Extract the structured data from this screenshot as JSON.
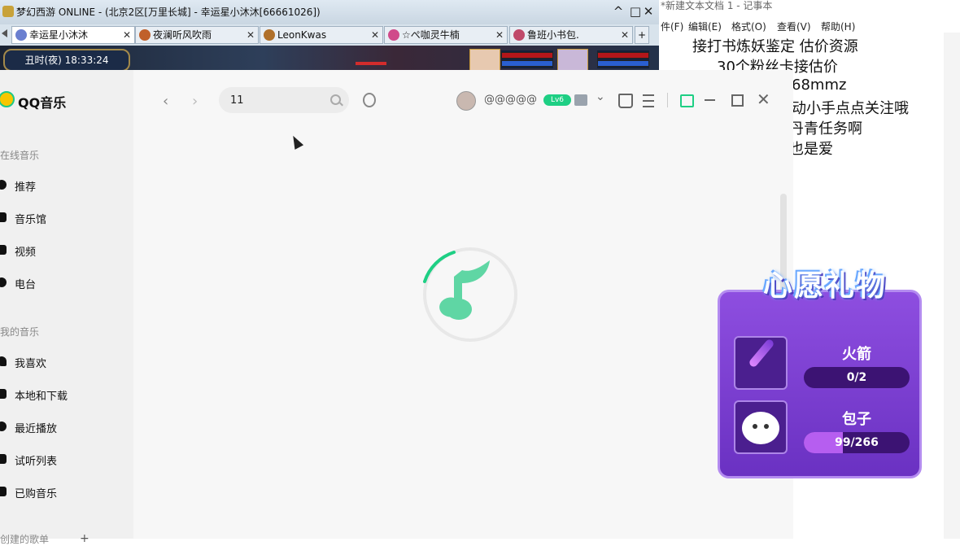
{
  "game": {
    "title": "梦幻西游 ONLINE - (北京2区[万里长城] - 幸运星小沐沐[66661026])",
    "clock": "丑时(夜) 18:33:24",
    "tabs": [
      {
        "label": "幸运星小沐沐",
        "active": true
      },
      {
        "label": "夜澜听风吹雨",
        "active": false
      },
      {
        "label": "LeonKwas",
        "active": false
      },
      {
        "label": "☆ぺ咖灵牛楠",
        "active": false
      },
      {
        "label": "鲁班小书包.",
        "active": false
      }
    ],
    "min_label": "^",
    "restore_label": "□",
    "close_label": "✕",
    "tab_close": "✕",
    "tab_add": "+"
  },
  "notepad": {
    "title": "*新建文本文档 1 - 记事本",
    "menu": [
      "件(F)",
      "编辑(E)",
      "格式(O)",
      "查看(V)",
      "帮助(H)"
    ],
    "lines": [
      "接打书炼妖鉴定 估价资源",
      "30个粉丝卡接估价",
      "68mmz",
      "动小手点点关注哦",
      "丹青任务啊",
      "也是爱"
    ]
  },
  "qqmusic": {
    "logo": "QQ音乐",
    "sidebar": {
      "online_head": "在线音乐",
      "online_items": [
        "推荐",
        "音乐馆",
        "视频",
        "电台"
      ],
      "mine_head": "我的音乐",
      "mine_items": [
        "我喜欢",
        "本地和下载",
        "最近播放",
        "试听列表",
        "已购音乐"
      ],
      "created_head": "创建的歌单",
      "create_plus": "+"
    },
    "nav": {
      "back": "‹",
      "forward": "›"
    },
    "search": {
      "value": "11"
    },
    "user": {
      "name": "@@@@@",
      "level": "Lv6"
    },
    "chevron": "⌄",
    "close_label": "✕",
    "accent": "#1ecf84"
  },
  "wish": {
    "title": "心愿礼物",
    "items": [
      {
        "name": "火箭",
        "current": 0,
        "total": 2,
        "count": "0/2",
        "icon": "rocket-icon"
      },
      {
        "name": "包子",
        "current": 99,
        "total": 266,
        "count": "99/266",
        "icon": "bun-icon"
      }
    ]
  }
}
